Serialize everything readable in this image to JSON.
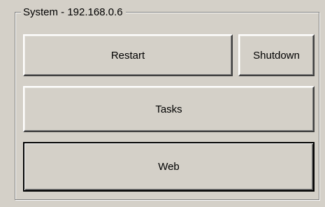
{
  "group": {
    "title": "System - 192.168.0.6"
  },
  "buttons": {
    "restart": "Restart",
    "shutdown": "Shutdown",
    "tasks": "Tasks",
    "web": "Web"
  },
  "colors": {
    "window_face": "#d4d0c8",
    "highlight": "#ffffff",
    "shadow": "#808080",
    "dark_shadow": "#404040"
  }
}
